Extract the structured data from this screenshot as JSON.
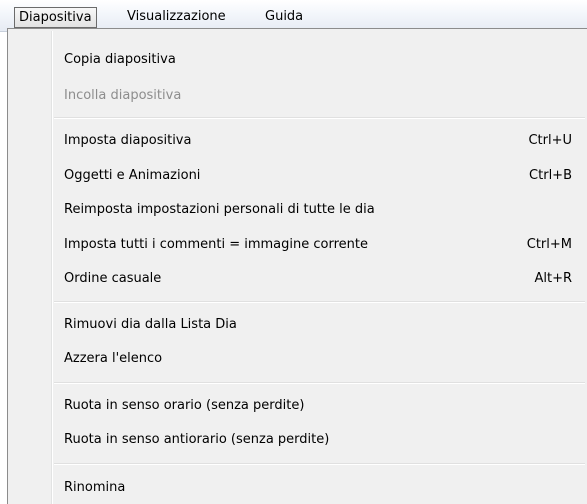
{
  "menubar": {
    "items": [
      {
        "label": "Diapositiva",
        "active": true
      },
      {
        "label": "Visualizzazione",
        "active": false
      },
      {
        "label": "Guida",
        "active": false
      }
    ]
  },
  "menu": {
    "items": [
      {
        "label": "Copia diapositiva",
        "shortcut": "",
        "enabled": true
      },
      {
        "label": "Incolla diapositiva",
        "shortcut": "",
        "enabled": false
      },
      {
        "label": "Imposta diapositiva",
        "shortcut": "Ctrl+U",
        "enabled": true
      },
      {
        "label": "Oggetti e Animazioni",
        "shortcut": "Ctrl+B",
        "enabled": true
      },
      {
        "label": "Reimposta impostazioni personali di tutte le dia",
        "shortcut": "",
        "enabled": true
      },
      {
        "label": "Imposta tutti i commenti = immagine corrente",
        "shortcut": "Ctrl+M",
        "enabled": true
      },
      {
        "label": "Ordine casuale",
        "shortcut": "Alt+R",
        "enabled": true
      },
      {
        "label": "Rimuovi dia dalla Lista Dia",
        "shortcut": "",
        "enabled": true
      },
      {
        "label": "Azzera l'elenco",
        "shortcut": "",
        "enabled": true
      },
      {
        "label": "Ruota in senso orario (senza perdite)",
        "shortcut": "",
        "enabled": true
      },
      {
        "label": "Ruota in senso antiorario (senza perdite)",
        "shortcut": "",
        "enabled": true
      },
      {
        "label": "Rinomina",
        "shortcut": "",
        "enabled": true
      }
    ]
  }
}
